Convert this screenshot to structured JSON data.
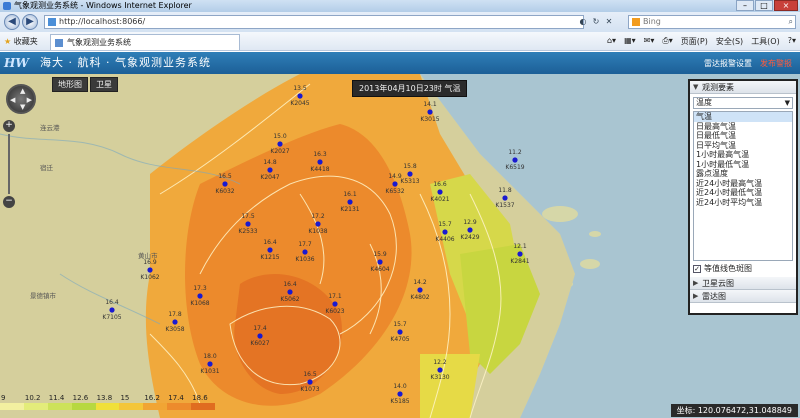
{
  "window": {
    "title": "气象观测业务系统 - Windows Internet Explorer"
  },
  "browser": {
    "url": "http://localhost:8066/",
    "search_placeholder": "Bing",
    "favorites_label": "收藏夹",
    "tab_title": "气象观测业务系统",
    "commands": [
      "页面(P)",
      "安全(S)",
      "工具(O)"
    ]
  },
  "app": {
    "logo": "HW",
    "title_prefix": "海大 · 航科 ·",
    "title_main": "气象观测业务系统",
    "links": [
      "雷达报警设置",
      "发布警报"
    ]
  },
  "map": {
    "type_buttons": [
      "地形图",
      "卫星"
    ],
    "label": "2013年04月10日23时 气温",
    "coordinates": "坐标: 120.076472,31.048849",
    "place_labels": [
      "连云港",
      "宿迁",
      "黄山市",
      "景德镇市"
    ],
    "stations": [
      {
        "id": "K2045",
        "v": "13.5"
      },
      {
        "id": "K3015",
        "v": "14.1"
      },
      {
        "id": "K2027",
        "v": "15.0"
      },
      {
        "id": "K2047",
        "v": "14.8"
      },
      {
        "id": "K6032",
        "v": "16.5"
      },
      {
        "id": "K4418",
        "v": "16.3"
      },
      {
        "id": "K5313",
        "v": "15.8"
      },
      {
        "id": "K6519",
        "v": "11.2"
      },
      {
        "id": "K2131",
        "v": "16.1"
      },
      {
        "id": "K6532",
        "v": "14.9"
      },
      {
        "id": "K2533",
        "v": "17.5"
      },
      {
        "id": "K4021",
        "v": "16.6"
      },
      {
        "id": "K1537",
        "v": "11.8"
      },
      {
        "id": "K1038",
        "v": "17.2"
      },
      {
        "id": "K1215",
        "v": "16.4"
      },
      {
        "id": "K4406",
        "v": "15.7"
      },
      {
        "id": "K2429",
        "v": "12.9"
      },
      {
        "id": "K1062",
        "v": "16.9"
      },
      {
        "id": "K1036",
        "v": "17.7"
      },
      {
        "id": "K4604",
        "v": "15.9"
      },
      {
        "id": "K2841",
        "v": "12.1"
      },
      {
        "id": "K1068",
        "v": "17.3"
      },
      {
        "id": "K5062",
        "v": "16.4"
      },
      {
        "id": "K6023",
        "v": "17.1"
      },
      {
        "id": "K4802",
        "v": "14.2"
      },
      {
        "id": "K7105",
        "v": "16.4"
      },
      {
        "id": "K3058",
        "v": "17.8"
      },
      {
        "id": "K6027",
        "v": "17.4"
      },
      {
        "id": "K4705",
        "v": "15.7"
      },
      {
        "id": "K1031",
        "v": "18.0"
      },
      {
        "id": "K3130",
        "v": "12.2"
      },
      {
        "id": "K1073",
        "v": "16.5"
      },
      {
        "id": "K5185",
        "v": "14.0"
      }
    ],
    "legend": [
      {
        "label": "9",
        "color": "#f2f0a0"
      },
      {
        "label": "10.2",
        "color": "#e3ec7a"
      },
      {
        "label": "11.4",
        "color": "#cde25a"
      },
      {
        "label": "12.6",
        "color": "#b7d840"
      },
      {
        "label": "13.8",
        "color": "#f0e03a"
      },
      {
        "label": "15",
        "color": "#f4c63a"
      },
      {
        "label": "16.2",
        "color": "#f1a534"
      },
      {
        "label": "17.4",
        "color": "#ed8b2c"
      },
      {
        "label": "18.6",
        "color": "#e06c20"
      }
    ]
  },
  "panel": {
    "section_observe": "观测要素",
    "select_value": "温度",
    "items": [
      "气温",
      "日最高气温",
      "日最低气温",
      "日平均气温",
      "1小时最高气温",
      "1小时最低气温",
      "露点温度",
      "近24小时最高气温",
      "近24小时最低气温",
      "近24小时平均气温"
    ],
    "checkbox_label": "等值线色斑图",
    "checkbox_checked": true,
    "section_satellite": "卫星云图",
    "section_radar": "雷达图"
  }
}
